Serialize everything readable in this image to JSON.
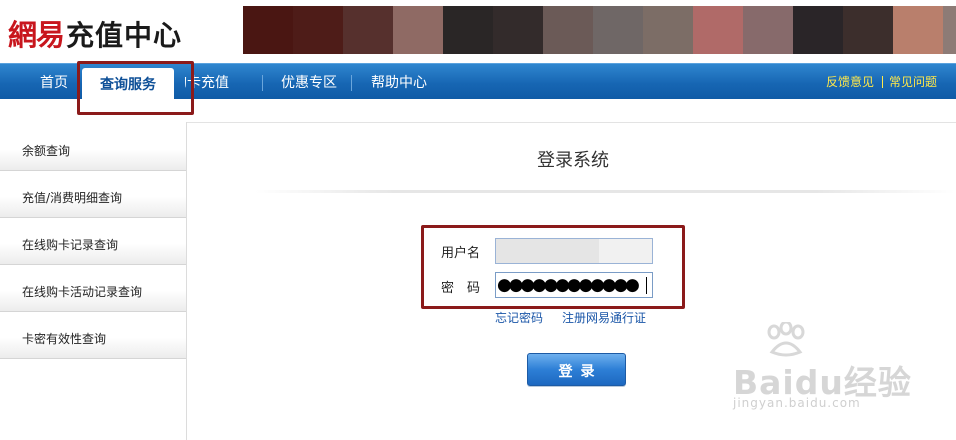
{
  "header": {
    "brand": "網易",
    "title": "充值中心",
    "banner_colors": [
      "#4a1612",
      "#4e1c18",
      "#56302d",
      "#8f6a64",
      "#2a2626",
      "#332b2b",
      "#6b5a57",
      "#6f6766",
      "#7c6d66",
      "#b06a68",
      "#876a6b",
      "#2a2528",
      "#3c2e2c",
      "#b97f6c",
      "#8d7b76"
    ]
  },
  "nav": {
    "items": [
      {
        "label": "首页"
      },
      {
        "label": "查询服务"
      },
      {
        "label": "购卡充值"
      },
      {
        "label": "优惠专区"
      },
      {
        "label": "帮助中心"
      }
    ],
    "right_links": [
      {
        "label": "反馈意见"
      },
      {
        "label": "常见问题"
      }
    ]
  },
  "sidebar": {
    "items": [
      {
        "label": "余额查询"
      },
      {
        "label": "充值/消费明细查询"
      },
      {
        "label": "在线购卡记录查询"
      },
      {
        "label": "在线购卡活动记录查询"
      },
      {
        "label": "卡密有效性查询"
      }
    ]
  },
  "login": {
    "title": "登录系统",
    "username_label": "用户名",
    "username_value": "",
    "password_label": "密　码",
    "password_value": "●●●●●●●●●●●●",
    "forgot_link": "忘记密码",
    "register_link": "注册网易通行证",
    "submit_label": "登录"
  },
  "watermark": {
    "logo_text": "Baidu经验",
    "url": "jingyan.baidu.com"
  },
  "colors": {
    "nav_blue": "#1766b3",
    "highlight": "#8b1a1a",
    "brand_red": "#c8161d",
    "link_yellow": "#ffe84a"
  }
}
